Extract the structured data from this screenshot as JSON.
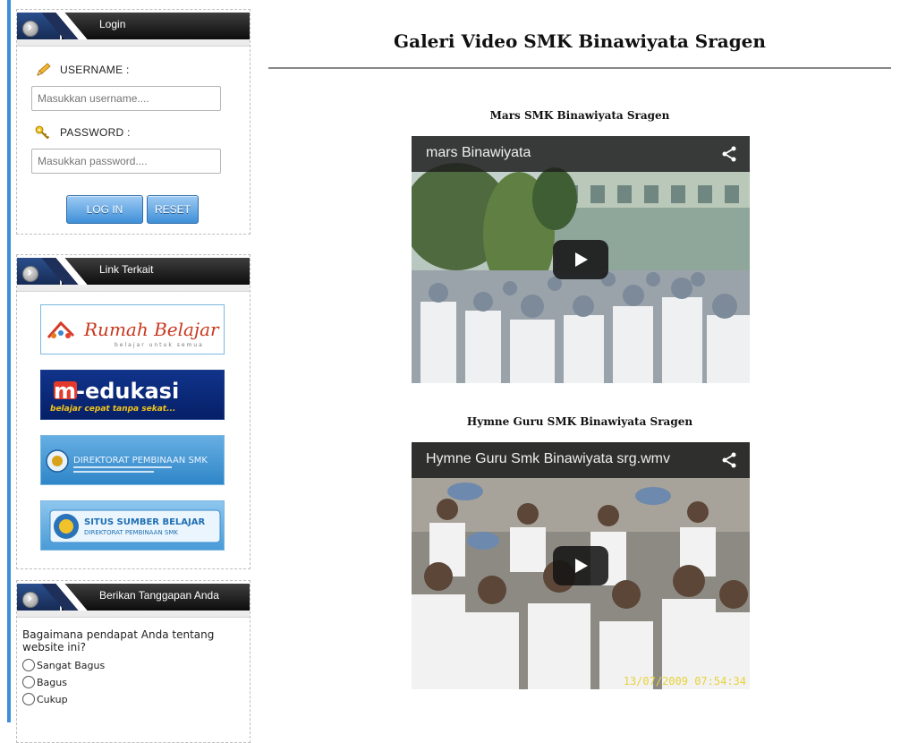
{
  "sidebar": {
    "login": {
      "title": "Login",
      "username_label": "USERNAME :",
      "username_placeholder": "Masukkan username....",
      "password_label": "PASSWORD :",
      "password_placeholder": "Masukkan password....",
      "login_button": "LOG IN",
      "reset_button": "RESET"
    },
    "links": {
      "title": "Link Terkait",
      "items": [
        {
          "name": "Rumah Belajar",
          "line1": "Rumah Belajar",
          "line2": "belajar untuk semua"
        },
        {
          "name": "m-edukasi",
          "line1": "m-edukasi",
          "line2": "belajar cepat tanpa sekat..."
        },
        {
          "name": "Direktorat Pembinaan SMK",
          "line1": "DIREKTORAT PEMBINAAN SMK"
        },
        {
          "name": "Situs Sumber Belajar",
          "line1": "SITUS SUMBER BELAJAR",
          "line2": "DIREKTORAT PEMBINAAN SMK"
        }
      ]
    },
    "poll": {
      "title": "Berikan Tanggapan Anda",
      "question": "Bagaimana pendapat Anda tentang website ini?",
      "options": [
        "Sangat Bagus",
        "Bagus",
        "Cukup"
      ]
    }
  },
  "main": {
    "page_title": "Galeri Video SMK Binawiyata Sragen",
    "videos": [
      {
        "heading": "Mars SMK Binawiyata Sragen",
        "player_title": "mars Binawiyata"
      },
      {
        "heading": "Hymne Guru SMK Binawiyata Sragen",
        "player_title": "Hymne Guru Smk Binawiyata srg.wmv",
        "timestamp": "13/07/2009 07:54:34"
      }
    ]
  },
  "colors": {
    "accent": "#3d8fd8",
    "header_dark": "#0d0d0d",
    "button_blue": "#3f8fd9"
  }
}
